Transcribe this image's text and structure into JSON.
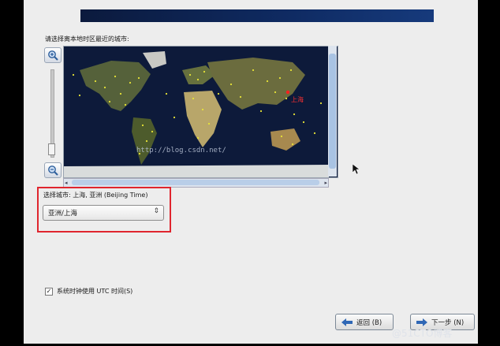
{
  "prompt": "请选择离本地时区最近的城市:",
  "map": {
    "city_marker_label": "上海",
    "watermark": "http://blog.csdn.net/"
  },
  "selected": {
    "label": "选择城市: 上海, 亚洲 (Beijing Time)",
    "combo_value": "亚洲/上海"
  },
  "utc_checkbox": {
    "checked_mark": "✓",
    "label": "系统时钟使用 UTC 时间(S)"
  },
  "buttons": {
    "back": "返回 (B)",
    "next": "下一步 (N)"
  },
  "corner_watermark": "@51CTO博客",
  "colors": {
    "highlight": "#e0252e",
    "banner": "#0f2b63",
    "ocean": "#0d1a3a"
  }
}
